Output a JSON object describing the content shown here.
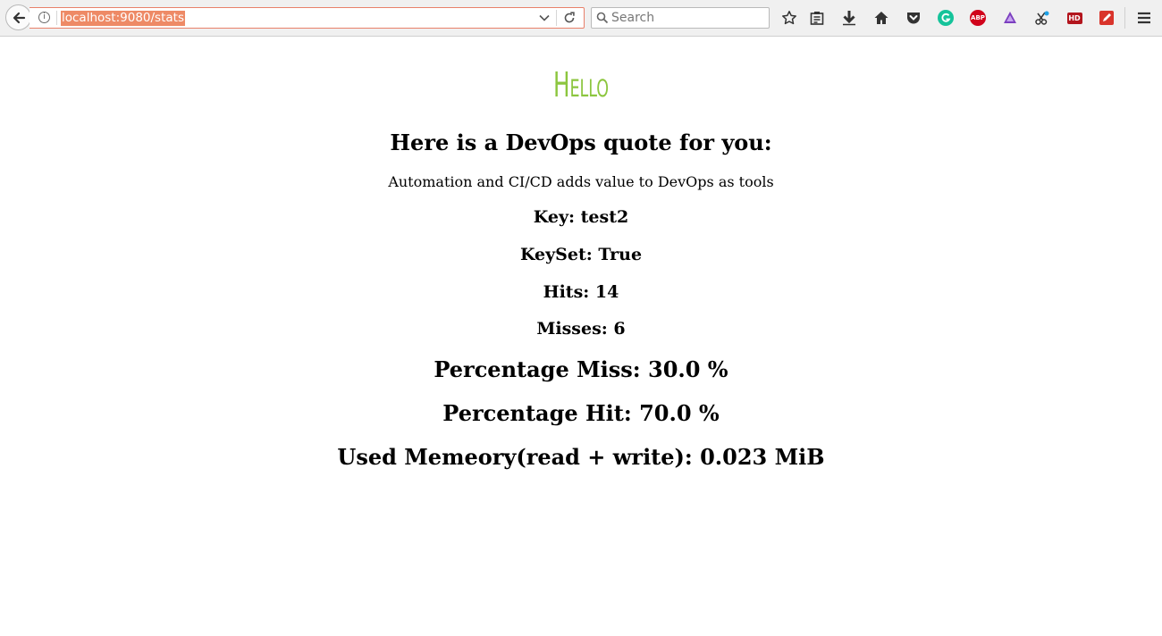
{
  "browser": {
    "url": "localhost:9080/stats",
    "search_placeholder": "Search",
    "extensions": {
      "abp_label": "ABP",
      "hd_label": "HD"
    }
  },
  "page": {
    "hello": "Hello",
    "quote_heading": "Here is a DevOps quote for you:",
    "quote_text": "Automation and CI/CD adds value to DevOps as tools",
    "key": "Key: test2",
    "keyset": "KeySet: True",
    "hits": "Hits: 14",
    "misses": "Misses: 6",
    "percentage_miss": "Percentage Miss: 30.0 %",
    "percentage_hit": "Percentage Hit: 70.0 %",
    "used_memory": "Used Memeory(read + write): 0.023 MiB"
  },
  "colors": {
    "hello_green": "#8cc63f",
    "url_highlight": "#ee8a66",
    "grammarly_green": "#15c39a",
    "abp_red": "#d0021b",
    "hd_red": "#b3151d"
  }
}
